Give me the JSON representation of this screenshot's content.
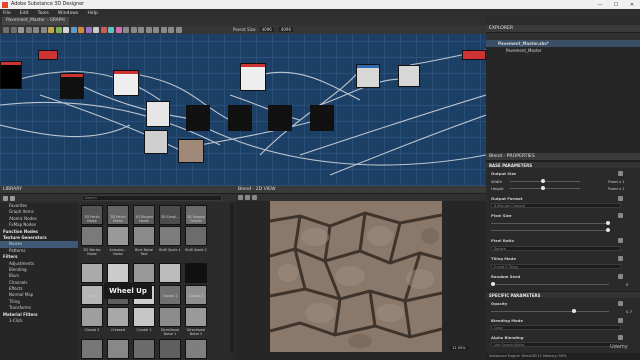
{
  "window": {
    "title": "Adobe Substance 3D Designer",
    "minimize": "—",
    "maximize": "☐",
    "close": "✕"
  },
  "menu": [
    "File",
    "Edit",
    "Tools",
    "Windows",
    "Help"
  ],
  "graph": {
    "tab_label": "Pavement_Master - GRAPH",
    "parent_size_label": "Parent Size:",
    "parent_size_value": "4096",
    "zoom_value": "4096"
  },
  "library": {
    "title": "LIBRARY",
    "search_placeholder": "Search",
    "tree": [
      {
        "label": "Favorites",
        "type": "item"
      },
      {
        "label": "Graph Items",
        "type": "item"
      },
      {
        "label": "Atomic Nodes",
        "type": "item"
      },
      {
        "label": "FxMap Nodes",
        "type": "item"
      },
      {
        "label": "Function Nodes",
        "type": "hdr"
      },
      {
        "label": "Texture Generators",
        "type": "hdr"
      },
      {
        "label": "Noises",
        "type": "sel"
      },
      {
        "label": "Patterns",
        "type": "item"
      },
      {
        "label": "Filters",
        "type": "hdr"
      },
      {
        "label": "Adjustments",
        "type": "item"
      },
      {
        "label": "Blending",
        "type": "item"
      },
      {
        "label": "Blurs",
        "type": "item"
      },
      {
        "label": "Channels",
        "type": "item"
      },
      {
        "label": "Effects",
        "type": "item"
      },
      {
        "label": "Normal Map",
        "type": "item"
      },
      {
        "label": "Tiling",
        "type": "item"
      },
      {
        "label": "Transforms",
        "type": "item"
      },
      {
        "label": "Material Filters",
        "type": "hdr"
      },
      {
        "label": "1-Click",
        "type": "item"
      }
    ],
    "thumbs": [
      "3D Perlin Noise",
      "3D Perlin Noise",
      "3D Ridged Noise",
      "3D Simpl...",
      "3D Voronoi Fractal",
      "3D Worley Noise",
      "Anisotro... Noise",
      "Blue Noise Fast",
      "BnW Spots 1",
      "BnW Spots 2",
      "",
      "",
      "",
      "",
      "",
      "Cells 1",
      "",
      "Cells 4",
      "Clouds 1",
      "Clouds 2",
      "Clouds 3",
      "Creased",
      "Crystal 1",
      "Directional Noise 1",
      "Directional Noise 2"
    ],
    "tooltip": "Wheel Up"
  },
  "view2d": {
    "title": "Blend - 2D VIEW",
    "zoom_readout": "12.50%"
  },
  "explorer": {
    "title": "EXPLORER",
    "package": "Pavement_Master.sbs*",
    "graph": "Pavement_Master"
  },
  "properties": {
    "title": "Blend - PROPERTIES",
    "base_section": "BASE PARAMETERS",
    "output_size": "Output Size",
    "width_label": "Width",
    "height_label": "Height",
    "width_value": "Fixed x 1",
    "height_value": "Fixed x 1",
    "output_format": "Output Format",
    "output_format_value": "8 Bits per Channel",
    "pixel_size": "Pixel Size",
    "pixel_ratio": "Pixel Ratio",
    "pixel_ratio_value": "Square",
    "tiling_mode": "Tiling Mode",
    "tiling_mode_value": "H and V Tiling",
    "random_seed": "Random Seed",
    "random_seed_value": "0",
    "specific_section": "SPECIFIC PARAMETERS",
    "opacity": "Opacity",
    "opacity_value": "0.7",
    "opacity_level": 0.7,
    "blending_mode": "Blending Mode",
    "blending_mode_value": "Copy",
    "alpha_blending": "Alpha Blending",
    "alpha_blending_value": "Use Source Alpha"
  },
  "status": "Substance Engine: Direct3D 11  Memory: 50%",
  "watermark": "Udemy"
}
